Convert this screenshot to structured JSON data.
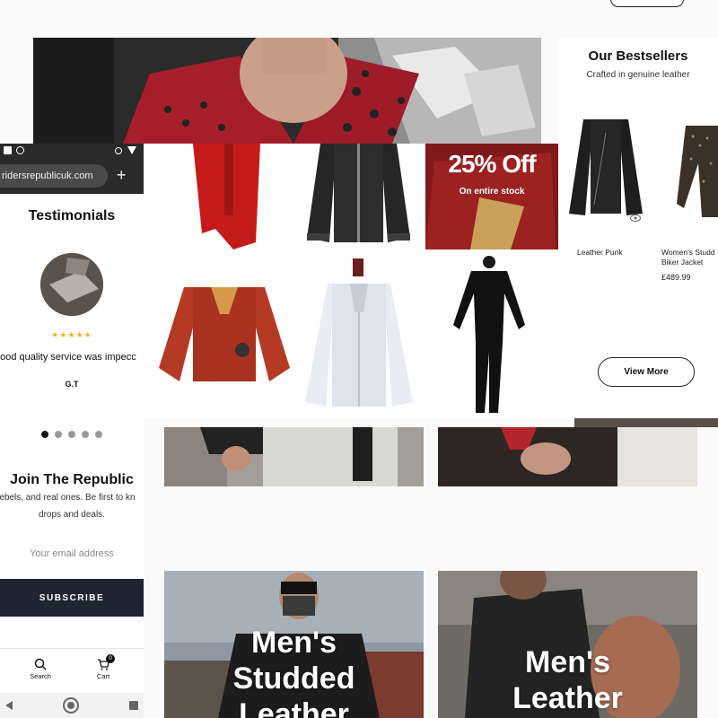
{
  "hero": {
    "alt_subject": "model in red studded jacket"
  },
  "promo_tile": {
    "big": "25% Off",
    "sub": "On entire stock"
  },
  "bestsellers": {
    "title": "Our Bestsellers",
    "subtitle": "Crafted in genuine leather",
    "products": [
      {
        "name": "Leather Punk",
        "price": ""
      },
      {
        "name": "Women's Studd Biker Jacket",
        "price": "£489.99"
      }
    ],
    "view_more": "View More"
  },
  "mobile": {
    "url": "ridersrepublicuk.com",
    "url_plus": "+",
    "testimonials_title": "Testimonials",
    "stars": "★★★★★",
    "quote": "good quality service was impecc",
    "author": "G.T",
    "dots": 5,
    "join_title": "Join The Republic",
    "join_sub1": "rebels, and real ones. Be first to kn",
    "join_sub2": "drops and deals.",
    "email_placeholder": "Your email address",
    "subscribe": "SUBSCRIBE",
    "nav": [
      {
        "label": "Search",
        "icon": "search-icon"
      },
      {
        "label": "Cart",
        "icon": "cart-icon",
        "badge": "0"
      }
    ]
  },
  "categories": [
    {
      "line1": "Men's",
      "line2": "Studded",
      "line3": "Leather"
    },
    {
      "line1": "Men's",
      "line2": "Leather"
    }
  ],
  "colors": {
    "accent_red": "#b3262d",
    "navy": "#1e2533",
    "star": "#f2b01e"
  }
}
